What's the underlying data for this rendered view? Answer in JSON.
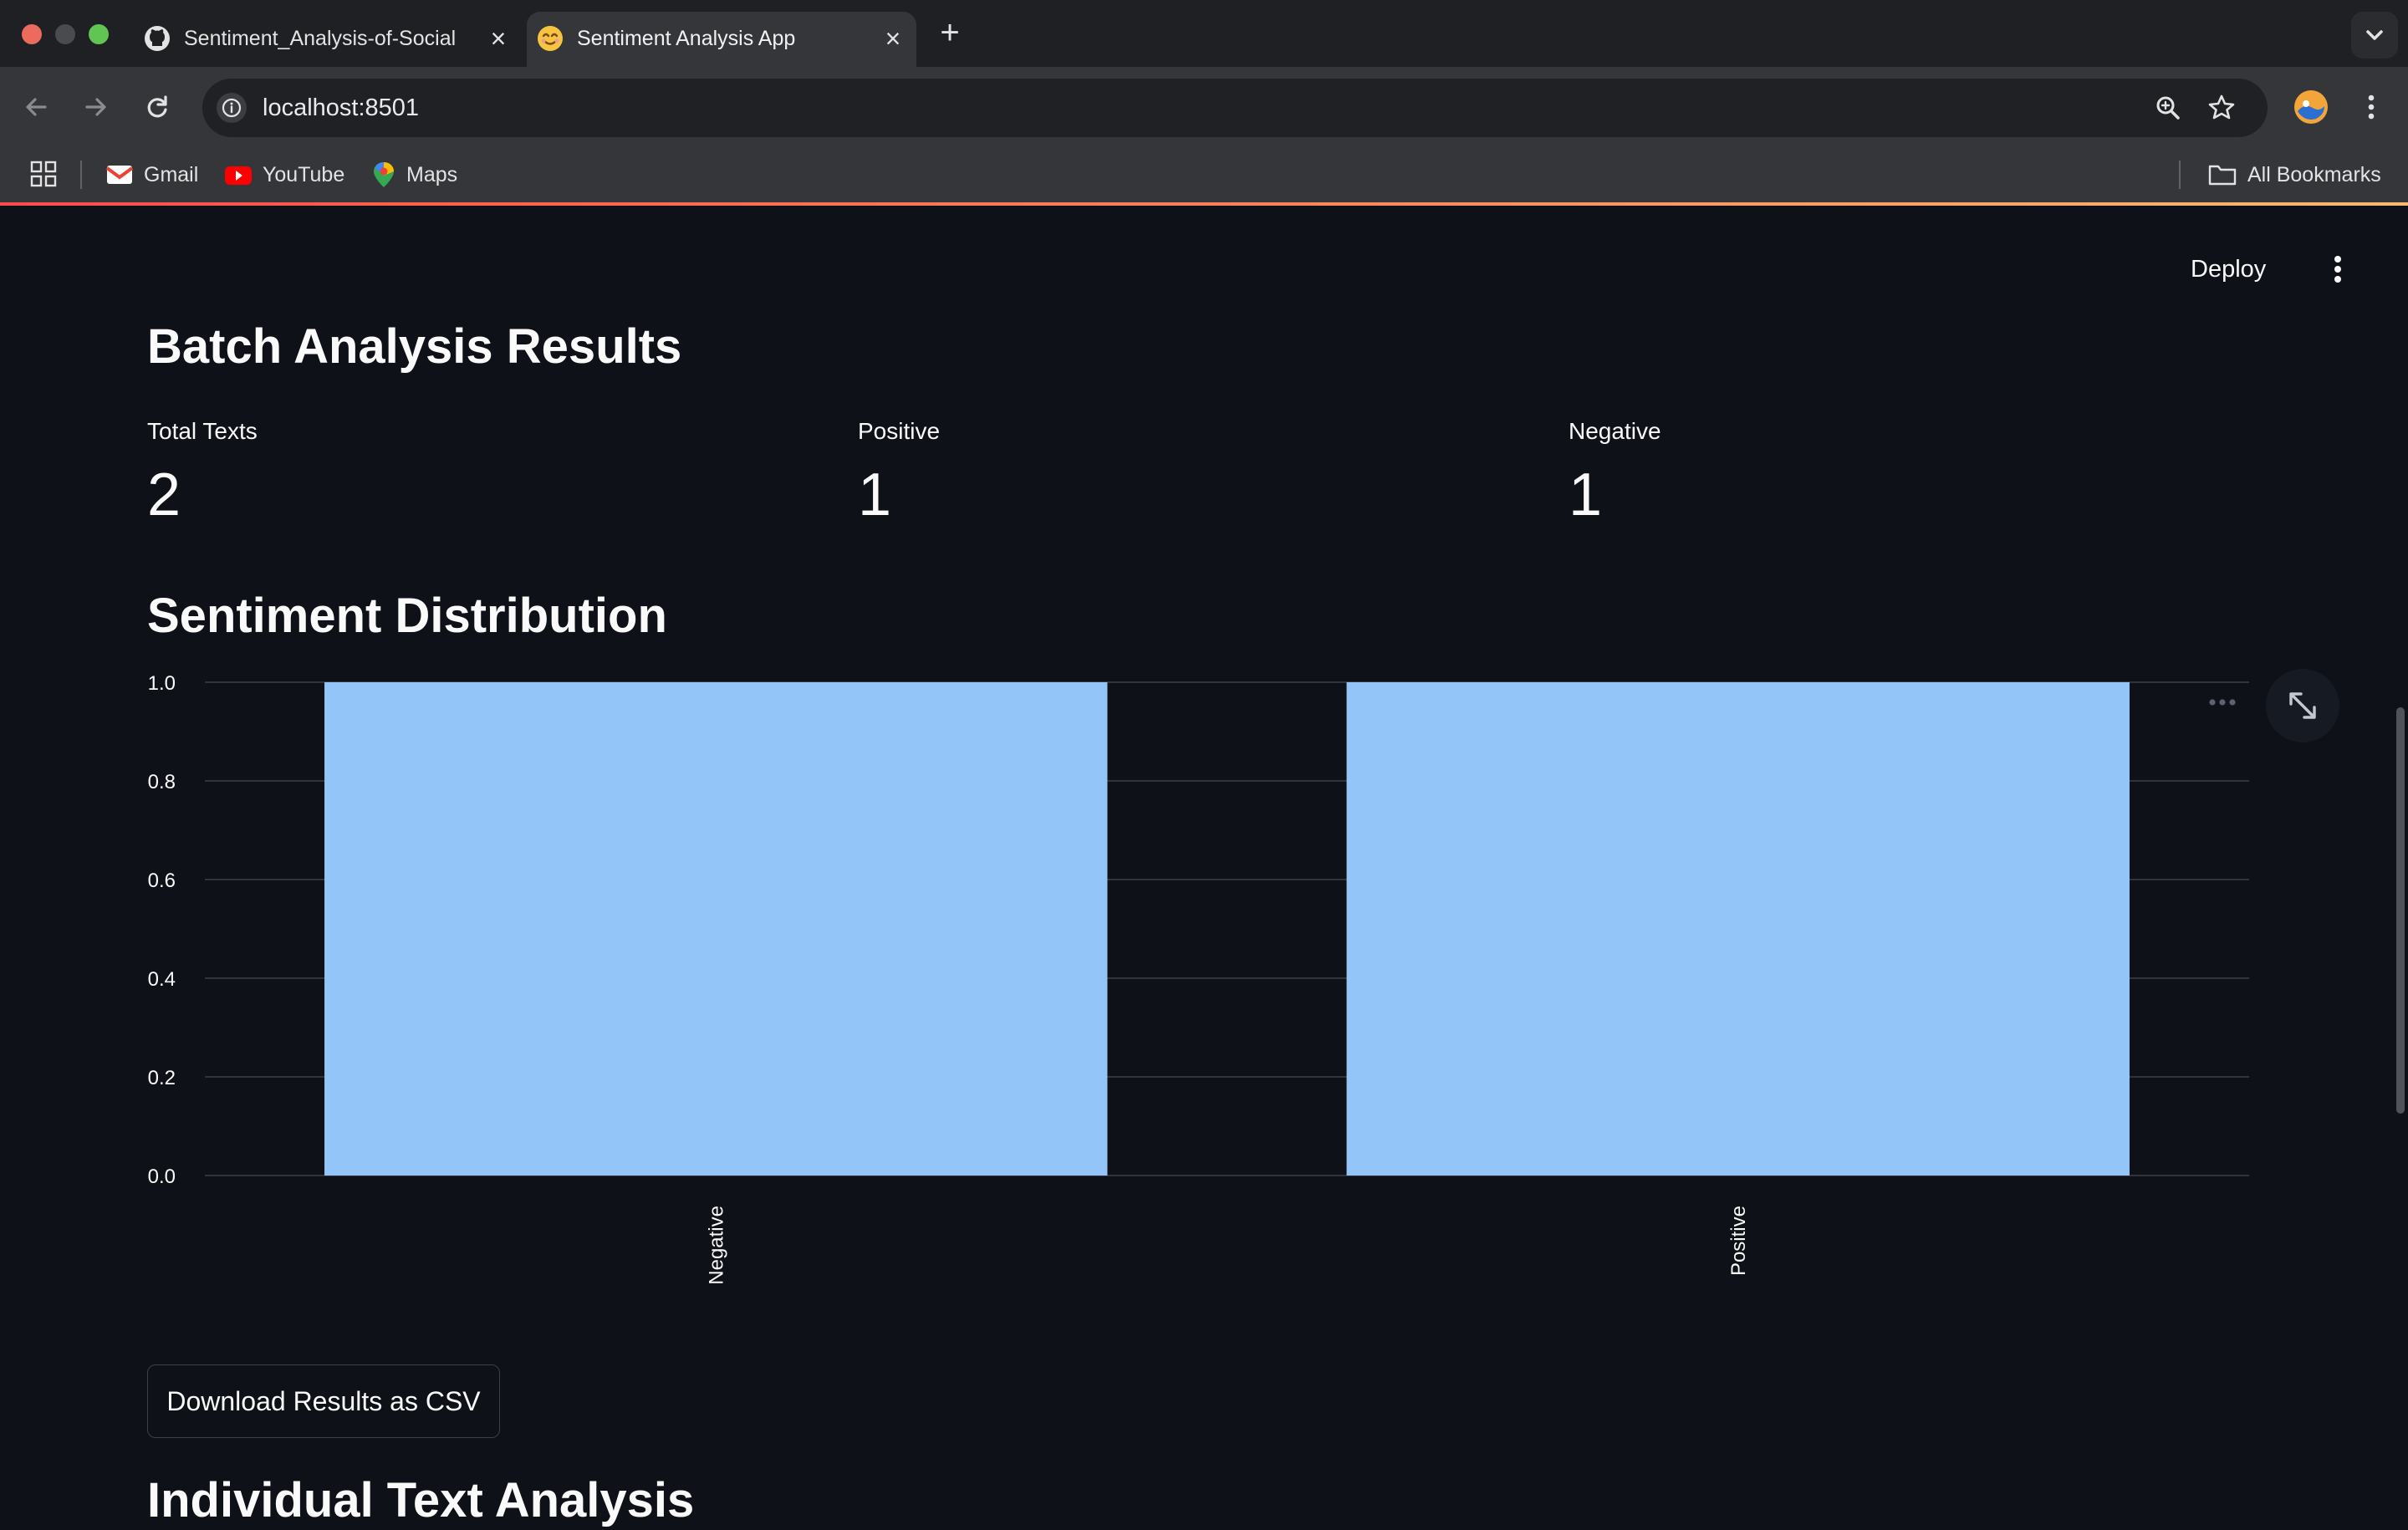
{
  "browser": {
    "tabs": [
      {
        "title": "Sentiment_Analysis-of-Social",
        "icon": "github-icon",
        "active": false
      },
      {
        "title": "Sentiment Analysis App",
        "icon": "smiley-icon",
        "active": true
      }
    ],
    "new_tab_symbol": "+",
    "url": "localhost:8501",
    "bookmarks": [
      {
        "label": "Gmail",
        "icon": "gmail-icon"
      },
      {
        "label": "YouTube",
        "icon": "youtube-icon"
      },
      {
        "label": "Maps",
        "icon": "maps-icon"
      }
    ],
    "all_bookmarks_label": "All Bookmarks"
  },
  "app": {
    "deploy_label": "Deploy",
    "heading": "Batch Analysis Results",
    "metrics": [
      {
        "label": "Total Texts",
        "value": "2"
      },
      {
        "label": "Positive",
        "value": "1"
      },
      {
        "label": "Negative",
        "value": "1"
      }
    ],
    "chart_heading": "Sentiment Distribution",
    "download_label": "Download Results as CSV",
    "next_heading": "Individual Text Analysis"
  },
  "colors": {
    "background": "#0e1117",
    "bar": "#93c5f8",
    "accent": "#ff4b4b"
  },
  "chart_data": {
    "type": "bar",
    "categories": [
      "Negative",
      "Positive"
    ],
    "values": [
      1,
      1
    ],
    "title": "",
    "xlabel": "",
    "ylabel": "",
    "ylim": [
      0,
      1
    ],
    "yticks": [
      "0.0",
      "0.2",
      "0.4",
      "0.6",
      "0.8",
      "1.0"
    ],
    "grid": true
  }
}
